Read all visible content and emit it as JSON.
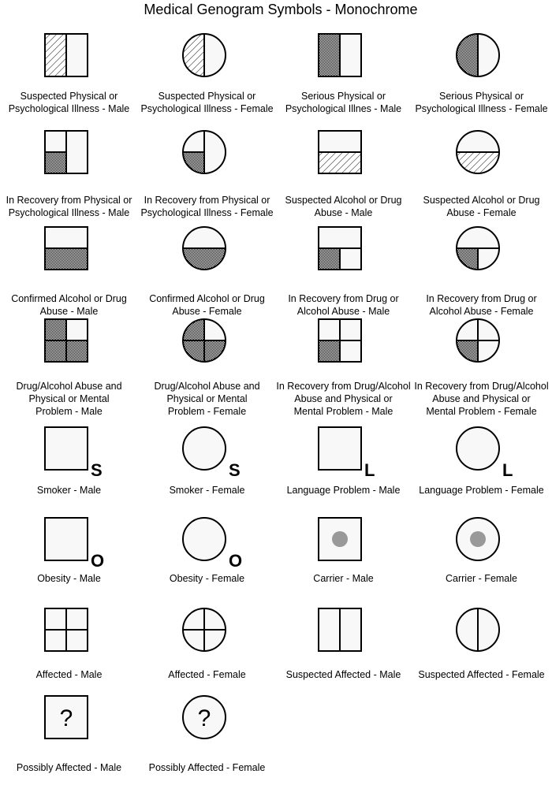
{
  "title": "Medical Genogram Symbols - Monochrome",
  "colors": {
    "stroke": "#000000",
    "fill": "#f8f8f8",
    "dot": "#999999"
  },
  "symbols": [
    {
      "label": "Suspected Physical or\nPsychological Illness - Male",
      "shape": "square",
      "pattern": "left-half-hatch"
    },
    {
      "label": "Suspected Physical or\nPsychological Illness - Female",
      "shape": "circle",
      "pattern": "left-half-hatch"
    },
    {
      "label": "Serious Physical or\nPsychological Illnes - Male",
      "shape": "square",
      "pattern": "left-half-dots"
    },
    {
      "label": "Serious Physical or\nPsychological Illness - Female",
      "shape": "circle",
      "pattern": "left-half-dots"
    },
    {
      "label": "In Recovery from Physical or\nPsychological Illness - Male",
      "shape": "square",
      "pattern": "recovery-physical"
    },
    {
      "label": "In Recovery from Physical or\nPsychological Illness - Female",
      "shape": "circle",
      "pattern": "recovery-physical"
    },
    {
      "label": "Suspected Alcohol or Drug\nAbuse - Male",
      "shape": "square",
      "pattern": "bottom-half-hatch"
    },
    {
      "label": "Suspected Alcohol or Drug\nAbuse - Female",
      "shape": "circle",
      "pattern": "bottom-half-hatch"
    },
    {
      "label": "Confirmed Alcohol or Drug\nAbuse - Male",
      "shape": "square",
      "pattern": "bottom-half-dots"
    },
    {
      "label": "Confirmed Alcohol or Drug\nAbuse - Female",
      "shape": "circle",
      "pattern": "bottom-half-dots"
    },
    {
      "label": "In Recovery from Drug or\nAlcohol Abuse - Male",
      "shape": "square",
      "pattern": "recovery-drug"
    },
    {
      "label": "In Recovery from Drug or\nAlcohol Abuse - Female",
      "shape": "circle",
      "pattern": "recovery-drug"
    },
    {
      "label": "Drug/Alcohol Abuse and\nPhysical or Mental\nProblem - Male",
      "shape": "square",
      "pattern": "three-quarters-dots"
    },
    {
      "label": "Drug/Alcohol Abuse and\nPhysical or Mental\nProblem - Female",
      "shape": "circle",
      "pattern": "three-quarters-dots"
    },
    {
      "label": "In Recovery from Drug/Alcohol\nAbuse and Physical or\nMental Problem - Male",
      "shape": "square",
      "pattern": "quarter-bl-dots"
    },
    {
      "label": "In Recovery from Drug/Alcohol\nAbuse and Physical or\nMental Problem - Female",
      "shape": "circle",
      "pattern": "quarter-bl-dots"
    },
    {
      "label": "Smoker - Male",
      "shape": "square",
      "pattern": "letter",
      "letter": "S"
    },
    {
      "label": "Smoker - Female",
      "shape": "circle",
      "pattern": "letter",
      "letter": "S"
    },
    {
      "label": "Language Problem - Male",
      "shape": "square",
      "pattern": "letter",
      "letter": "L"
    },
    {
      "label": "Language Problem - Female",
      "shape": "circle",
      "pattern": "letter",
      "letter": "L"
    },
    {
      "label": "Obesity - Male",
      "shape": "square",
      "pattern": "letter",
      "letter": "O"
    },
    {
      "label": "Obesity - Female",
      "shape": "circle",
      "pattern": "letter",
      "letter": "O"
    },
    {
      "label": "Carrier - Male",
      "shape": "square",
      "pattern": "dot"
    },
    {
      "label": "Carrier - Female",
      "shape": "circle",
      "pattern": "dot"
    },
    {
      "label": "Affected - Male",
      "shape": "square",
      "pattern": "cross"
    },
    {
      "label": "Affected - Female",
      "shape": "circle",
      "pattern": "cross"
    },
    {
      "label": "Suspected Affected - Male",
      "shape": "square",
      "pattern": "vertical-line"
    },
    {
      "label": "Suspected Affected - Female",
      "shape": "circle",
      "pattern": "vertical-line"
    },
    {
      "label": "Possibly Affected - Male",
      "shape": "square",
      "pattern": "question",
      "letter": "?"
    },
    {
      "label": "Possibly Affected - Female",
      "shape": "circle",
      "pattern": "question",
      "letter": "?"
    }
  ]
}
